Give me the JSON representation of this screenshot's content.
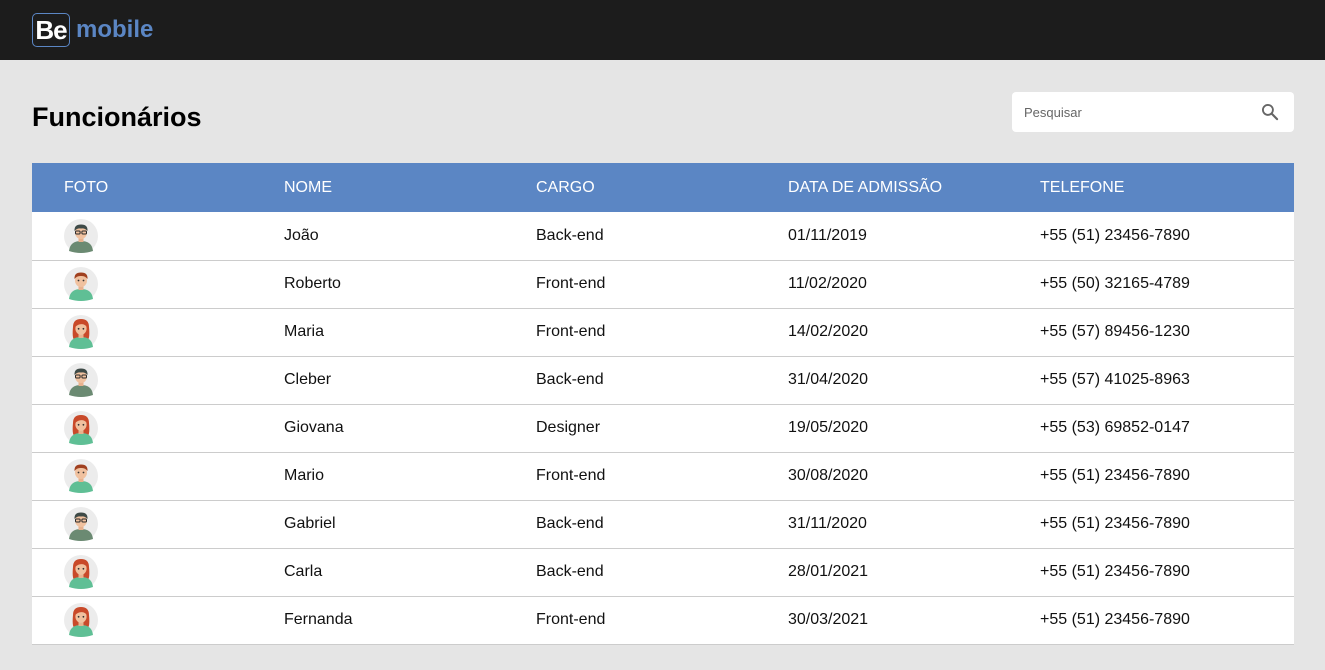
{
  "brand": {
    "logo_mark": "Be",
    "logo_text": "mobile",
    "colors": {
      "topbar": "#1c1c1c",
      "accent": "#5b86c4",
      "background": "#e5e5e5"
    }
  },
  "page": {
    "title": "Funcionários"
  },
  "search": {
    "placeholder": "Pesquisar",
    "value": "",
    "icon": "search-icon"
  },
  "table": {
    "headers": [
      "FOTO",
      "NOME",
      "CARGO",
      "DATA DE ADMISSÃO",
      "TELEFONE"
    ],
    "rows": [
      {
        "avatar": "man-glasses",
        "name": "João",
        "role": "Back-end",
        "admission": "01/11/2019",
        "phone": "+55 (51) 23456-7890"
      },
      {
        "avatar": "man",
        "name": "Roberto",
        "role": "Front-end",
        "admission": "11/02/2020",
        "phone": "+55 (50) 32165-4789"
      },
      {
        "avatar": "woman",
        "name": "Maria",
        "role": "Front-end",
        "admission": "14/02/2020",
        "phone": "+55 (57) 89456-1230"
      },
      {
        "avatar": "man-glasses",
        "name": "Cleber",
        "role": "Back-end",
        "admission": "31/04/2020",
        "phone": "+55 (57) 41025-8963"
      },
      {
        "avatar": "woman",
        "name": "Giovana",
        "role": "Designer",
        "admission": "19/05/2020",
        "phone": "+55 (53) 69852-0147"
      },
      {
        "avatar": "man",
        "name": "Mario",
        "role": "Front-end",
        "admission": "30/08/2020",
        "phone": "+55 (51) 23456-7890"
      },
      {
        "avatar": "man-glasses",
        "name": "Gabriel",
        "role": "Back-end",
        "admission": "31/11/2020",
        "phone": "+55 (51) 23456-7890"
      },
      {
        "avatar": "woman",
        "name": "Carla",
        "role": "Back-end",
        "admission": "28/01/2021",
        "phone": "+55 (51) 23456-7890"
      },
      {
        "avatar": "woman",
        "name": "Fernanda",
        "role": "Front-end",
        "admission": "30/03/2021",
        "phone": "+55 (51) 23456-7890"
      }
    ]
  }
}
